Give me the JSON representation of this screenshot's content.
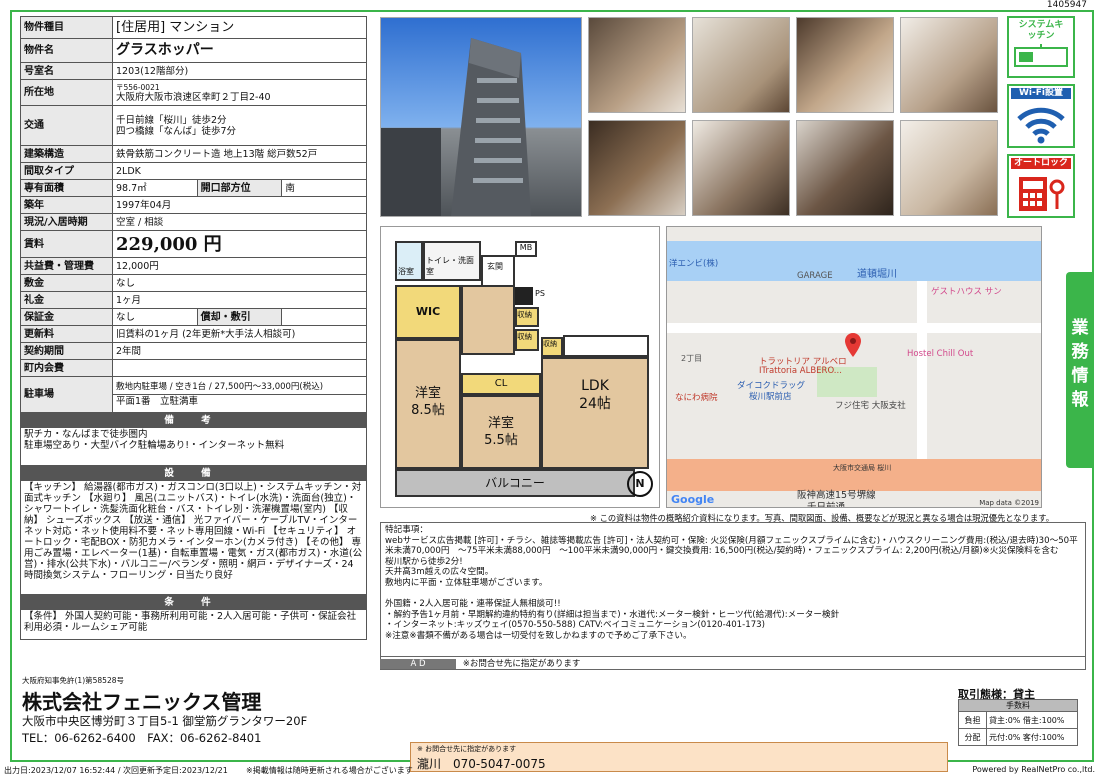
{
  "doc_id": "1405947",
  "spec": {
    "type_label": "物件種目",
    "type_value": "[住居用] マンション",
    "name_label": "物件名",
    "name_value": "グラスホッパー",
    "room_label": "号室名",
    "room_value": "1203(12階部分)",
    "addr_label": "所在地",
    "zip": "〒556-0021",
    "addr": "大阪府大阪市浪速区幸町２丁目2-40",
    "traffic_label": "交通",
    "traffic1": "千日前線「桜川」徒歩2分",
    "traffic2": "四つ橋線「なんば」徒歩7分",
    "structure_label": "建築構造",
    "structure_value": "鉄骨鉄筋コンクリート造 地上13階 総戸数52戸",
    "layout_label": "間取タイプ",
    "layout_value": "2LDK",
    "area_label": "専有面積",
    "area_value": "98.7㎡",
    "dir_label": "開口部方位",
    "dir_value": "南",
    "built_label": "築年",
    "built_value": "1997年04月",
    "status_label": "現況/入居時期",
    "status_value": "空室 / 相談",
    "rent_label": "賃料",
    "rent_value": "229,000 円",
    "fee_label": "共益費・管理費",
    "fee_value": "12,000円",
    "deposit_label": "敷金",
    "deposit_value": "なし",
    "key_label": "礼金",
    "key_value": "1ヶ月",
    "hosho_label": "保証金",
    "hosho_value": "なし",
    "shokyaku_label": "償却・敷引",
    "shokyaku_value": "",
    "renew_label": "更新料",
    "renew_value": "旧賃料の1ヶ月 (2年更新*大手法人相談可)",
    "period_label": "契約期間",
    "period_value": "2年間",
    "town_label": "町内会費",
    "town_value": "",
    "parking_label": "駐車場",
    "parking1": "敷地内駐車場 / 空き1台 / 27,500円～33,000円(税込)",
    "parking2": "平面1番　立駐満車"
  },
  "biko": {
    "title": "備 考",
    "text": "駅チカ・なんばまで徒歩圏内\n駐車場空あり・大型バイク駐輪場あり!・インターネット無料"
  },
  "setsubi": {
    "title": "設 備",
    "text": "【キッチン】 給湯器(都市ガス)・ガスコンロ(3口以上)・システムキッチン・対面式キッチン 【水廻り】 風呂(ユニットバス)・トイレ(水洗)・洗面台(独立)・シャワートイレ・洗髪洗面化粧台・バス・トイレ別・洗濯機置場(室内) 【収納】 シューズボックス 【放送・通信】 光ファイバー・ケーブルTV・インターネット対応・ネット使用料不要・ネット専用回線・Wi-Fi 【セキュリティ】 オートロック・宅配BOX・防犯カメラ・インターホン(カメラ付き) 【その他】 専用ごみ置場・エレベーター(1基)・自転車置場・電気・ガス(都市ガス)・水道(公営)・排水(公共下水)・バルコニー/ベランダ・照明・網戸・デザイナーズ・24時間換気システム・フローリング・日当たり良好"
  },
  "joken": {
    "title": "条 件",
    "text": "【条件】 外国人契約可能・事務所利用可能・2人入居可能・子供可・保証会社利用必須・ルームシェア可能"
  },
  "badges": [
    "システムキッチン",
    "Wi-Fi設置",
    "オートロック"
  ],
  "side_tab": "業務情報",
  "floor": {
    "bath": "浴室",
    "toilet": "トイレ・洗面室",
    "genkan": "玄関",
    "mb": "MB",
    "ps": "PS",
    "wic": "WIC",
    "shuno1": "収納",
    "shuno2": "収納",
    "shuno3": "収納",
    "cl": "CL",
    "room1": "洋室",
    "room1_size": "8.5帖",
    "room2": "洋室",
    "room2_size": "5.5帖",
    "ldk": "LDK",
    "ldk_size": "24帖",
    "balcony": "バルコニー",
    "north": "N"
  },
  "map": {
    "l1": "洋エンビ(株)",
    "l2": "道頓堀川",
    "l3": "GARAGE",
    "l4": "ゲストハウス サン",
    "l5": "トラットリア アルベロ",
    "l6": "ITrattoria ALBERO...",
    "l7": "Hostel Chill Out",
    "l8": "ダイコクドラッグ",
    "l9": "桜川駅前店",
    "l10": "フジ住宅 大阪支社",
    "l11": "なにわ病院",
    "l12": "大阪市交通局 桜川",
    "l13": "阪神高速15号堺線",
    "l14": "千日前通",
    "l15": "Google",
    "l16": "Map data ©2019",
    "l17": "2丁目"
  },
  "disclaimer": "※ この資料は物件の概略紹介資料になります。写真、間取図面、設備、概要などが現況と異なる場合は現況優先となります。",
  "notes": "特記事項：\nwebサービス広告掲載 [許可]・チラシ、雑誌等掲載広告 [許可]・法人契約可・保険: 火災保険(月額フェニックスプライムに含む)・ハウスクリーニング費用:(税込/退去時)30～50平米未満70,000円　～75平米未満88,000円　～100平米未満90,000円・鍵交換費用: 16,500円(税込/契約時)・フェニックスプライム: 2,200円(税込/月額)※火災保険料を含む\n桜川駅から徒歩2分!\n天井高3m越えの広々空間。\n敷地内に平面・立体駐車場がございます。\n\n外国籍・2人入居可能・連帯保証人無相談可!!\n・解約予告1ヶ月前・早期解約違約特約有り(詳細は担当まで)・水道代:メーター検針・ヒーツ代(給湯代):メーター検針\n・インターネット:キッズウェイ(0570-550-588) CATV:ベイコミュニケーション(0120-401-173)\n※注意※書類不備がある場合は一切受付を致しかねますので予めご了承下さい。",
  "ad": {
    "label": "A D",
    "text": "※お問合せ先に指定があります"
  },
  "company": {
    "license": "大阪府知事免許(1)第58528号",
    "name": "株式会社フェニックス管理",
    "addr": "大阪市中央区博労町３丁目5-1 御堂筋グランタワー20F",
    "tel": "TEL：06-6262-6400　FAX：06-6262-8401"
  },
  "torihiki": {
    "label": "取引態様：",
    "value": "貸主",
    "fee_head": "手数料",
    "r1": "負担",
    "r1v": "貸主:0% 借主:100%",
    "r2": "分配",
    "r2v": "元付:0% 客付:100%"
  },
  "contact": {
    "note": "※ お問合せ先に指定があります",
    "name": "瀧川",
    "tel": "070-5047-0075"
  },
  "footer": {
    "left": "出力日:2023/12/07 16:52:44 / 次回更新予定日:2023/12/21",
    "mid": "※掲載情報は随時更新される場合がございます",
    "right": "Powered by RealNetPro co.,ltd."
  }
}
